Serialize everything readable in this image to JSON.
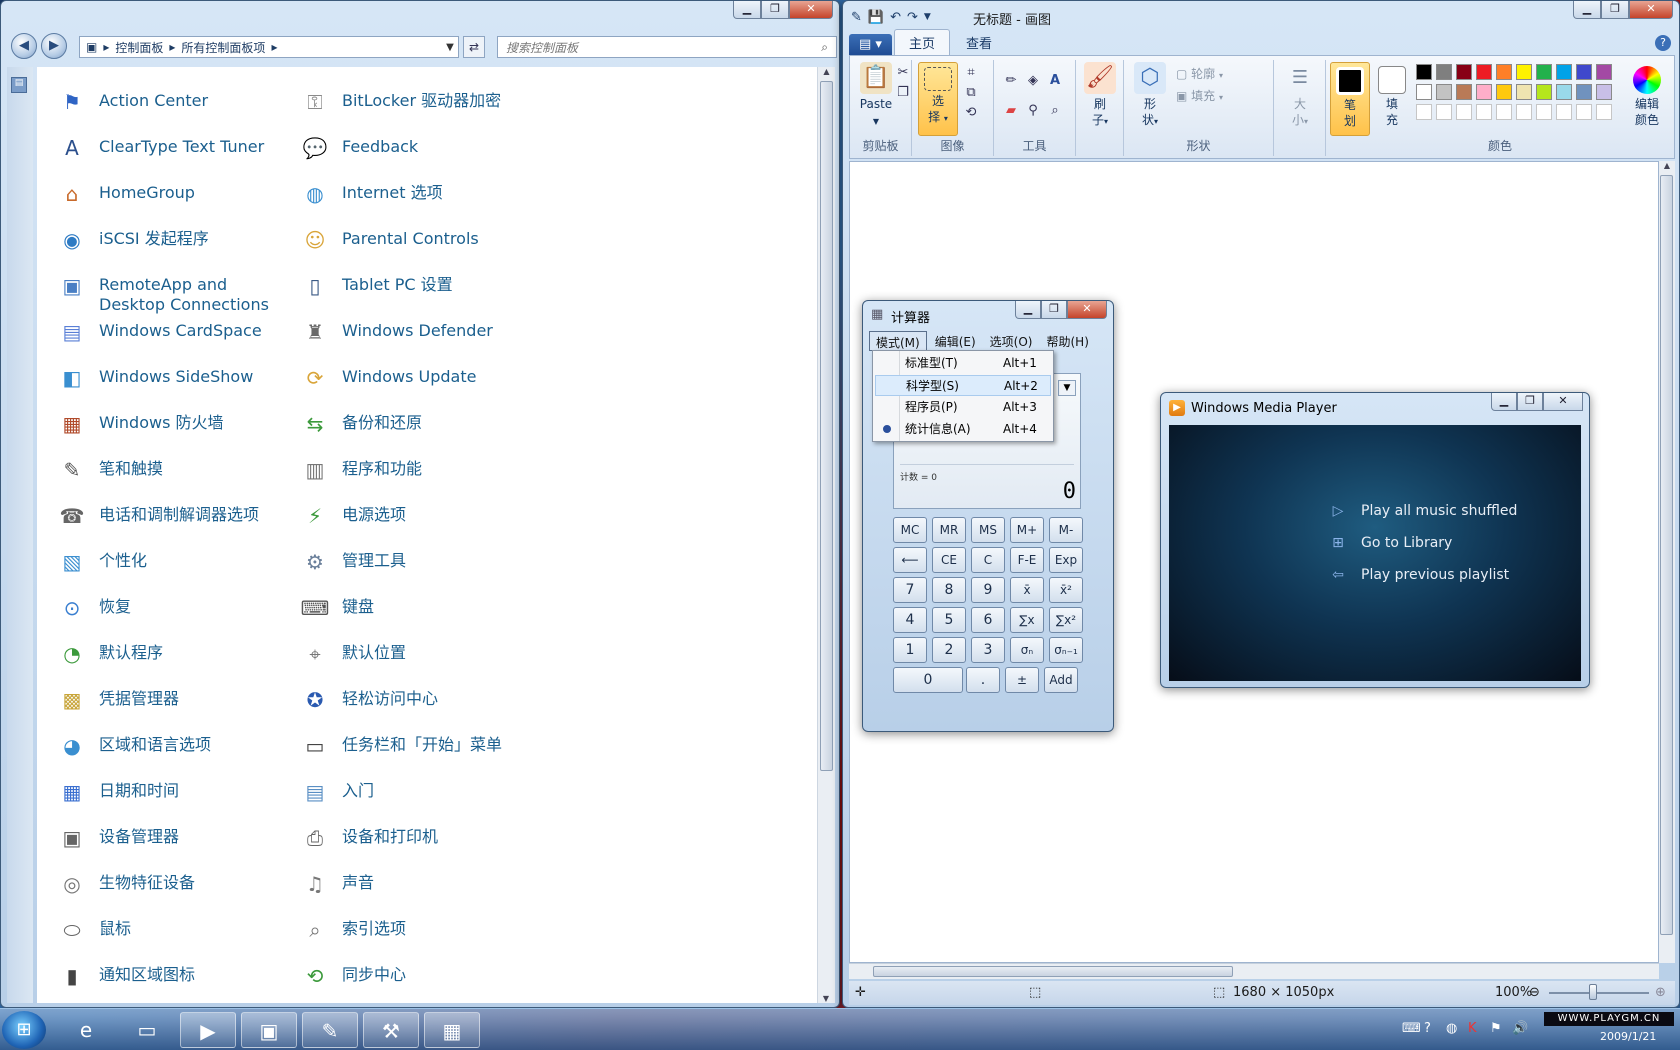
{
  "control_panel": {
    "address": [
      "控制面板",
      "所有控制面板项"
    ],
    "search_placeholder": "搜索控制面板",
    "items": [
      {
        "label": "Action Center",
        "icon": "flag-icon",
        "glyph": "⚑",
        "color": "#2f64c4"
      },
      {
        "label": "BitLocker 驱动器加密",
        "icon": "key-icon",
        "glyph": "⚿",
        "color": "#8a8a8a"
      },
      {
        "label": "ClearType Text Tuner",
        "icon": "cleartype-icon",
        "glyph": "A",
        "color": "#2b4f8c"
      },
      {
        "label": "Feedback",
        "icon": "chat-bubble-icon",
        "glyph": "💬",
        "color": "#3c6fbf"
      },
      {
        "label": "HomeGroup",
        "icon": "house-icon",
        "glyph": "⌂",
        "color": "#c86a2b"
      },
      {
        "label": "Internet 选项",
        "icon": "globe-icon",
        "glyph": "◍",
        "color": "#3a8fd0"
      },
      {
        "label": "iSCSI 发起程序",
        "icon": "globe-network-icon",
        "glyph": "◉",
        "color": "#2e7bc4"
      },
      {
        "label": "Parental Controls",
        "icon": "family-icon",
        "glyph": "☺",
        "color": "#d9a53a"
      },
      {
        "label": "RemoteApp and Desktop Connections",
        "icon": "remote-desktop-icon",
        "glyph": "▣",
        "color": "#4a7fc4"
      },
      {
        "label": "Tablet PC 设置",
        "icon": "tablet-icon",
        "glyph": "▯",
        "color": "#3b5a85"
      },
      {
        "label": "Windows CardSpace",
        "icon": "cardspace-icon",
        "glyph": "▤",
        "color": "#5a7fd6"
      },
      {
        "label": "Windows Defender",
        "icon": "castle-icon",
        "glyph": "♜",
        "color": "#6a6a6a"
      },
      {
        "label": "Windows SideShow",
        "icon": "sideshow-icon",
        "glyph": "◧",
        "color": "#3a8fd0"
      },
      {
        "label": "Windows Update",
        "icon": "update-icon",
        "glyph": "⟳",
        "color": "#d9a53a"
      },
      {
        "label": "Windows 防火墙",
        "icon": "firewall-icon",
        "glyph": "▦",
        "color": "#b04a2a"
      },
      {
        "label": "备份和还原",
        "icon": "backup-icon",
        "glyph": "⇆",
        "color": "#3c9a3c"
      },
      {
        "label": "笔和触摸",
        "icon": "pen-icon",
        "glyph": "✎",
        "color": "#555"
      },
      {
        "label": "程序和功能",
        "icon": "programs-icon",
        "glyph": "▥",
        "color": "#777"
      },
      {
        "label": "电话和调制解调器选项",
        "icon": "phone-icon",
        "glyph": "☎",
        "color": "#666"
      },
      {
        "label": "电源选项",
        "icon": "battery-icon",
        "glyph": "⚡",
        "color": "#3c9a3c"
      },
      {
        "label": "个性化",
        "icon": "personalize-icon",
        "glyph": "▧",
        "color": "#3c8fd0"
      },
      {
        "label": "管理工具",
        "icon": "admin-tools-icon",
        "glyph": "⚙",
        "color": "#6a7f9a"
      },
      {
        "label": "恢复",
        "icon": "recovery-icon",
        "glyph": "⊙",
        "color": "#3a7fd0"
      },
      {
        "label": "键盘",
        "icon": "keyboard-icon",
        "glyph": "⌨",
        "color": "#555"
      },
      {
        "label": "默认程序",
        "icon": "default-programs-icon",
        "glyph": "◔",
        "color": "#3c9a3c"
      },
      {
        "label": "默认位置",
        "icon": "location-icon",
        "glyph": "⌖",
        "color": "#777"
      },
      {
        "label": "凭据管理器",
        "icon": "vault-icon",
        "glyph": "▩",
        "color": "#c8a53a"
      },
      {
        "label": "轻松访问中心",
        "icon": "accessibility-icon",
        "glyph": "✪",
        "color": "#2a5ab0"
      },
      {
        "label": "区域和语言选项",
        "icon": "region-icon",
        "glyph": "◕",
        "color": "#3a8fd0"
      },
      {
        "label": "任务栏和「开始」菜单",
        "icon": "taskbar-icon",
        "glyph": "▭",
        "color": "#444"
      },
      {
        "label": "日期和时间",
        "icon": "calendar-icon",
        "glyph": "▦",
        "color": "#3a6fd0"
      },
      {
        "label": "入门",
        "icon": "getting-started-icon",
        "glyph": "▤",
        "color": "#5a8fc4"
      },
      {
        "label": "设备管理器",
        "icon": "device-manager-icon",
        "glyph": "▣",
        "color": "#666"
      },
      {
        "label": "设备和打印机",
        "icon": "printer-icon",
        "glyph": "⎙",
        "color": "#666"
      },
      {
        "label": "生物特征设备",
        "icon": "fingerprint-icon",
        "glyph": "◎",
        "color": "#777"
      },
      {
        "label": "声音",
        "icon": "speaker-icon",
        "glyph": "♫",
        "color": "#777"
      },
      {
        "label": "鼠标",
        "icon": "mouse-icon",
        "glyph": "⬭",
        "color": "#666"
      },
      {
        "label": "索引选项",
        "icon": "index-search-icon",
        "glyph": "⌕",
        "color": "#777"
      },
      {
        "label": "通知区域图标",
        "icon": "notification-icon",
        "glyph": "▮",
        "color": "#444"
      },
      {
        "label": "同步中心",
        "icon": "sync-icon",
        "glyph": "⟲",
        "color": "#3c9a3c"
      }
    ]
  },
  "paint": {
    "title": "无标题 - 画图",
    "tabs": [
      "主页",
      "查看"
    ],
    "groups": {
      "clipboard": "剪贴板",
      "image": "图像",
      "tools": "工具",
      "shapes": "形状",
      "colors": "颜色"
    },
    "buttons": {
      "paste": "Paste",
      "select_1": "选",
      "select_2": "择",
      "brushes_1": "刷",
      "brushes_2": "子",
      "shapes_1": "形",
      "shapes_2": "状",
      "outline": "轮廓",
      "fill": "填充",
      "size_1": "大",
      "size_2": "小",
      "color1_1": "笔",
      "color1_2": "划",
      "color2_1": "填",
      "color2_2": "充",
      "edit_colors_1": "编辑",
      "edit_colors_2": "颜色"
    },
    "palette": [
      "#000000",
      "#7f7f7f",
      "#880015",
      "#ed1c24",
      "#ff7f27",
      "#fff200",
      "#22b14c",
      "#00a2e8",
      "#3f48cc",
      "#a349a4",
      "#ffffff",
      "#c3c3c3",
      "#b97a57",
      "#ffaec9",
      "#ffc90e",
      "#efe4b0",
      "#b5e61d",
      "#99d9ea",
      "#7092be",
      "#c8bfe7"
    ],
    "status": {
      "size": "1680 × 1050px",
      "zoom": "100%"
    }
  },
  "calculator": {
    "title": "计算器",
    "menu": [
      "模式(M)",
      "编辑(E)",
      "选项(O)",
      "帮助(H)"
    ],
    "dropdown": [
      {
        "label": "标准型(T)",
        "key": "Alt+1"
      },
      {
        "label": "科学型(S)",
        "key": "Alt+2"
      },
      {
        "label": "程序员(P)",
        "key": "Alt+3"
      },
      {
        "label": "统计信息(A)",
        "key": "Alt+4"
      }
    ],
    "memory_label": "计数 = 0",
    "display": "0",
    "keys": [
      [
        "MC",
        "MR",
        "MS",
        "M+",
        "M-"
      ],
      [
        "⟵",
        "CE",
        "C",
        "F-E",
        "Exp"
      ],
      [
        "7",
        "8",
        "9",
        "x̄",
        "x̄²"
      ],
      [
        "4",
        "5",
        "6",
        "∑x",
        "∑x²"
      ],
      [
        "1",
        "2",
        "3",
        "σₙ",
        "σₙ₋₁"
      ],
      [
        "0",
        ".",
        "±",
        "Add"
      ]
    ]
  },
  "wmp": {
    "title": "Windows Media Player",
    "links": [
      {
        "label": "Play all music shuffled",
        "icon": "play-icon",
        "glyph": "▷"
      },
      {
        "label": "Go to Library",
        "icon": "library-icon",
        "glyph": "⊞"
      },
      {
        "label": "Play previous playlist",
        "icon": "back-arrow-icon",
        "glyph": "⇦"
      }
    ]
  },
  "taskbar": {
    "apps": [
      {
        "icon": "internet-explorer-icon",
        "glyph": "e",
        "open": false
      },
      {
        "icon": "explorer-folder-icon",
        "glyph": "▭",
        "open": false
      },
      {
        "icon": "media-player-icon",
        "glyph": "▶",
        "open": true
      },
      {
        "icon": "control-panel-icon",
        "glyph": "▣",
        "open": true
      },
      {
        "icon": "paint-icon",
        "glyph": "✎",
        "open": true
      },
      {
        "icon": "tools-icon",
        "glyph": "⚒",
        "open": true
      },
      {
        "icon": "calculator-icon",
        "glyph": "▦",
        "open": true
      }
    ],
    "logo": "WWW.PLAYGM.CN",
    "date": "2009/1/21"
  }
}
